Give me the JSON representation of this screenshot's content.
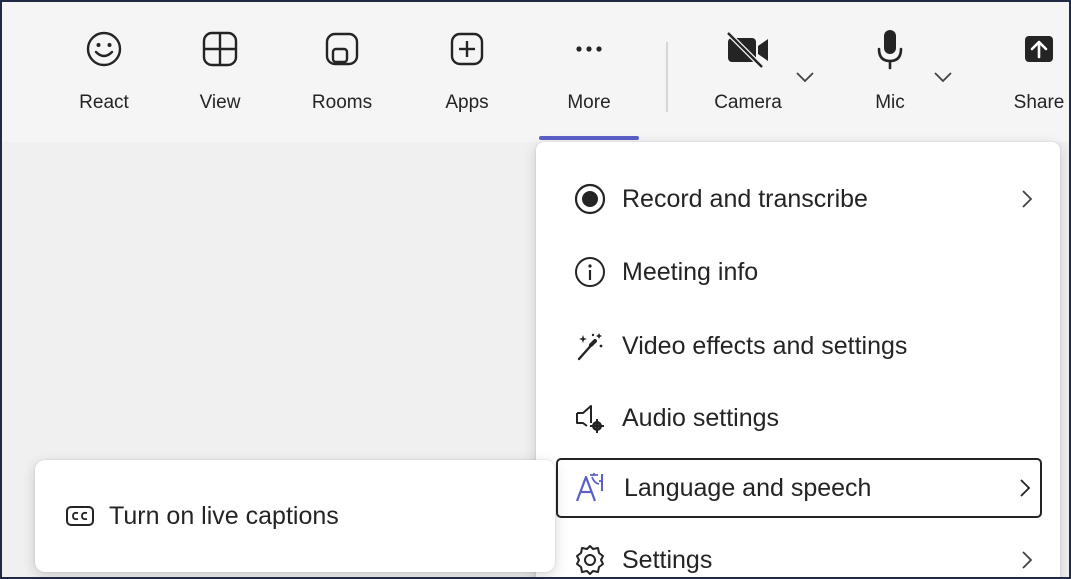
{
  "toolbar": {
    "buttons": [
      {
        "label": "React",
        "icon": "smiley-icon"
      },
      {
        "label": "View",
        "icon": "grid-icon"
      },
      {
        "label": "Rooms",
        "icon": "rooms-icon"
      },
      {
        "label": "Apps",
        "icon": "plus-square-icon"
      },
      {
        "label": "More",
        "icon": "ellipsis-icon",
        "selected": true
      },
      {
        "label": "Camera",
        "icon": "camera-off-icon"
      },
      {
        "label": "Mic",
        "icon": "mic-icon"
      },
      {
        "label": "Share",
        "icon": "share-icon"
      }
    ]
  },
  "more_menu": {
    "items": [
      {
        "label": "Record and transcribe",
        "icon": "record-icon",
        "has_submenu": true
      },
      {
        "label": "Meeting info",
        "icon": "info-icon",
        "has_submenu": false
      },
      {
        "label": "Video effects and settings",
        "icon": "magic-wand-icon",
        "has_submenu": false
      },
      {
        "label": "Audio settings",
        "icon": "speaker-gear-icon",
        "has_submenu": false
      },
      {
        "label": "Language and speech",
        "icon": "language-icon",
        "has_submenu": true,
        "focused": true
      },
      {
        "label": "Settings",
        "icon": "gear-icon",
        "has_submenu": true
      }
    ]
  },
  "submenu": {
    "items": [
      {
        "label": "Turn on live captions",
        "icon": "cc-icon"
      }
    ]
  },
  "colors": {
    "accent": "#5b5fc7",
    "language_icon": "#5b5fc7"
  }
}
